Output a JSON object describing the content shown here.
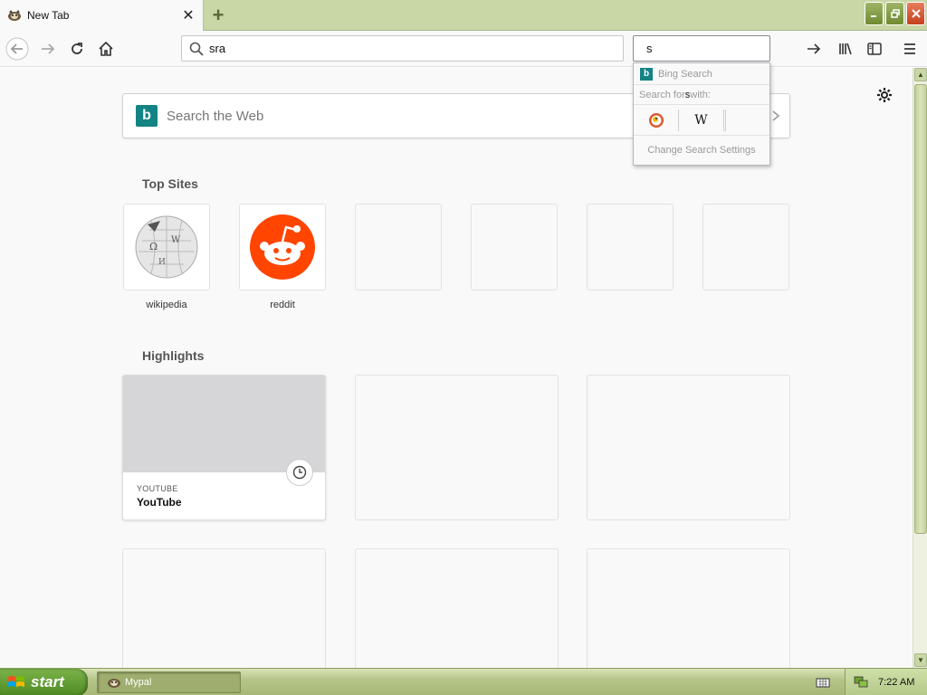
{
  "colors": {
    "accent": "#138384",
    "reddit": "#ff4500",
    "xp_green": "#4d8a22",
    "tab_strip": "#c9d6a6"
  },
  "tab": {
    "title": "New Tab",
    "favicon": "mypal-raccoon-icon"
  },
  "toolbar": {
    "url_value": "sra",
    "search_value": "s"
  },
  "newtab": {
    "search_placeholder": "Search the Web",
    "top_sites_title": "Top Sites",
    "top_sites": [
      {
        "label": "wikipedia",
        "icon": "wikipedia-globe-icon"
      },
      {
        "label": "reddit",
        "icon": "reddit-alien-icon"
      },
      {
        "label": ""
      },
      {
        "label": ""
      },
      {
        "label": ""
      },
      {
        "label": ""
      }
    ],
    "highlights_title": "Highlights",
    "highlights": [
      {
        "source": "YOUTUBE",
        "title": "YouTube"
      }
    ]
  },
  "dropdown": {
    "engine_label": "Bing Search",
    "search_for_prefix": "Search for ",
    "search_for_query": "s",
    "search_for_suffix": " with:",
    "engines": [
      "duckduckgo-icon",
      "wikipedia-w-icon"
    ],
    "wikipedia_letter": "W",
    "settings_label": "Change Search Settings"
  },
  "taskbar": {
    "start_label": "start",
    "task_label": "Mypal",
    "clock": "7:22 AM"
  }
}
